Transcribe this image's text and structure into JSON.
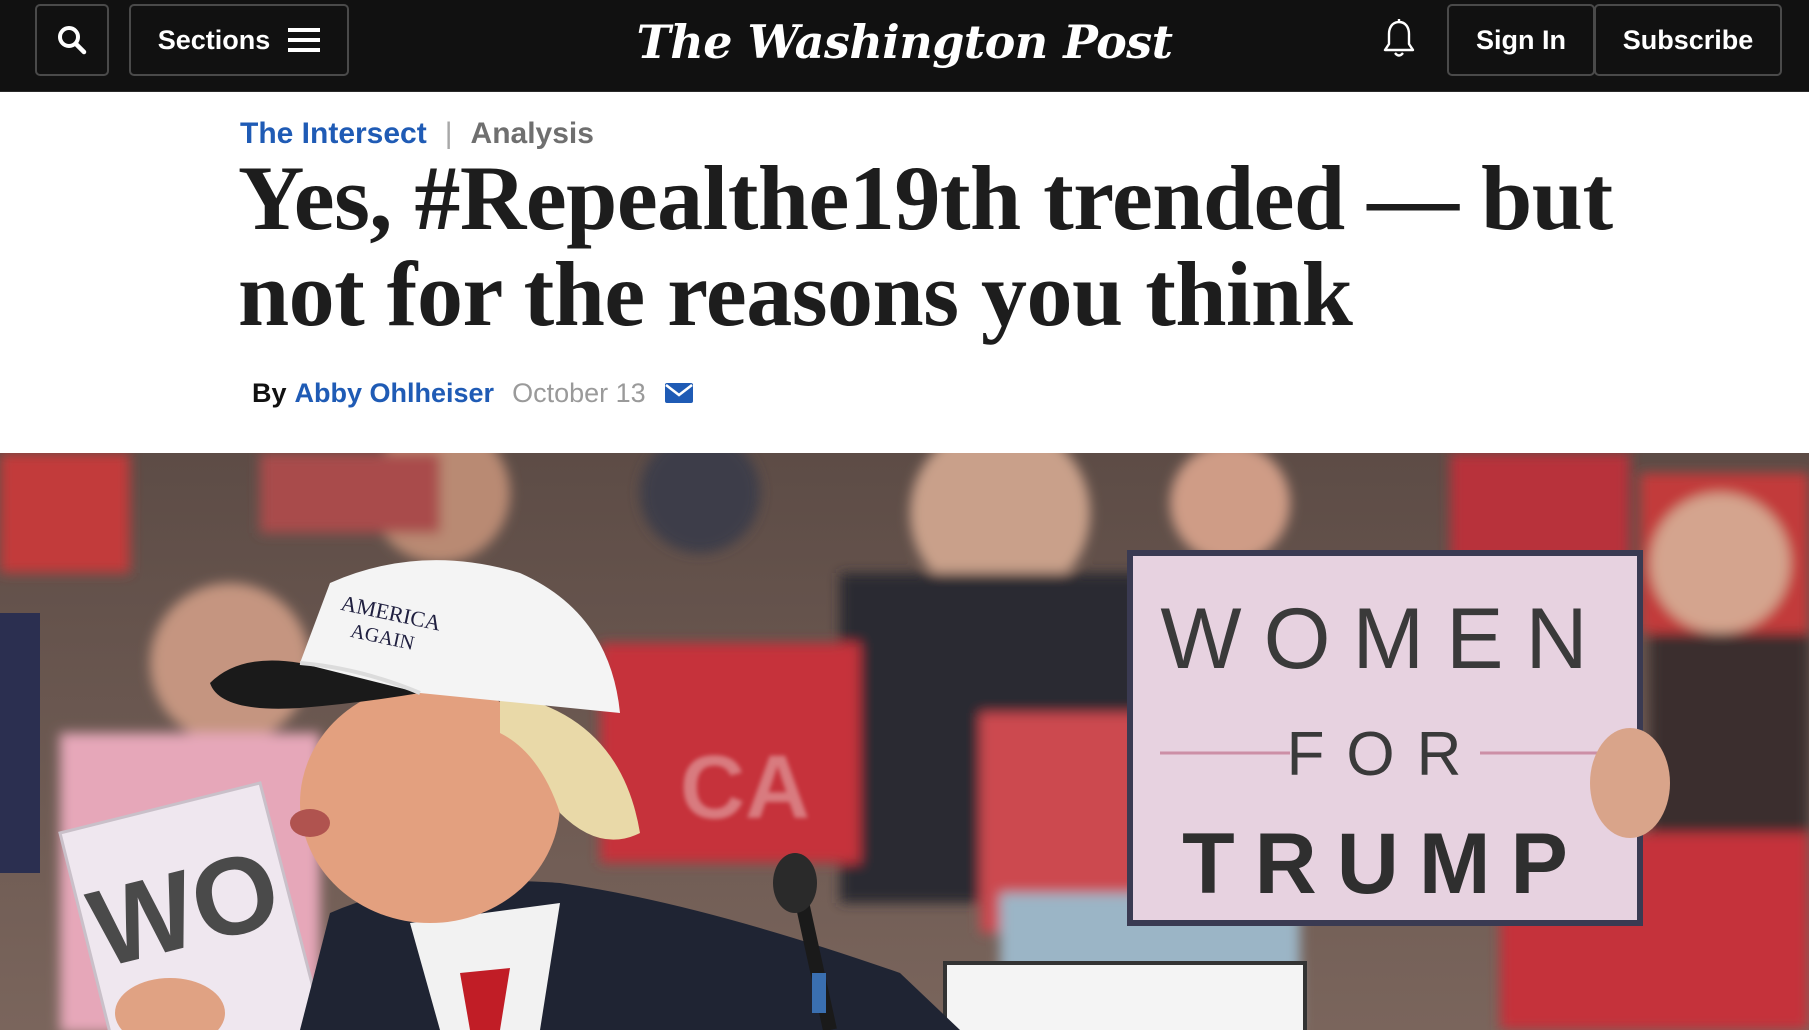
{
  "header": {
    "sections_label": "Sections",
    "masthead": "The Washington Post",
    "signin_label": "Sign In",
    "subscribe_label": "Subscribe",
    "icons": [
      "search-icon",
      "menu-icon",
      "bell-icon"
    ]
  },
  "article": {
    "kicker_section": "The Intersect",
    "kicker_divider": "|",
    "kicker_label": "Analysis",
    "headline_line1": "Yes, #Repealthe19th trended — but",
    "headline_line2": "not for the reasons you think",
    "byline_prefix": "By",
    "author": "Abby Ohlheiser",
    "date": "October 13",
    "email_icon": "envelope-icon"
  },
  "photo": {
    "sign_right_line1": "WOMEN",
    "sign_right_line2": "FOR",
    "sign_right_line3": "TRUMP",
    "sign_left_partial": "WO",
    "cap_line1": "AMERICA",
    "cap_line2": "AGAIN",
    "background_sign_partial": "CA"
  },
  "colors": {
    "topbar": "#111111",
    "link_blue": "#1f5bb5",
    "headline": "#1d1d1d",
    "muted": "#9a9a9a",
    "sign_pink": "#e7d2e0"
  }
}
